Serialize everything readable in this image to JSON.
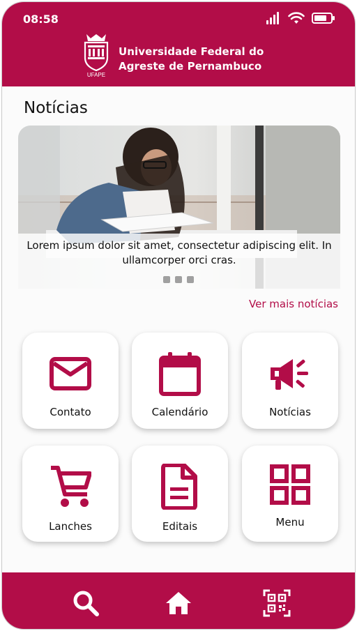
{
  "status_bar": {
    "time": "08:58"
  },
  "header": {
    "logo_text": "UFAPE",
    "title_line1": "Universidade Federal do",
    "title_line2": "Agreste de Pernambuco"
  },
  "news": {
    "section_title": "Notícias",
    "caption": "Lorem ipsum dolor sit amet, consectetur adipiscing elit. In ullamcorper orci cras.",
    "slides_count": 3,
    "more_link": "Ver mais notícias"
  },
  "tiles": [
    {
      "label": "Contato",
      "icon": "mail-icon"
    },
    {
      "label": "Calendário",
      "icon": "calendar-icon"
    },
    {
      "label": "Notícias",
      "icon": "megaphone-icon"
    },
    {
      "label": "Lanches",
      "icon": "cart-icon"
    },
    {
      "label": "Editais",
      "icon": "document-icon"
    },
    {
      "label": "Menu",
      "icon": "grid-icon"
    }
  ],
  "bottom_nav": [
    "search-icon",
    "home-icon",
    "qr-code-icon"
  ],
  "colors": {
    "brand": "#b20d48",
    "background": "#fbfbfb"
  }
}
